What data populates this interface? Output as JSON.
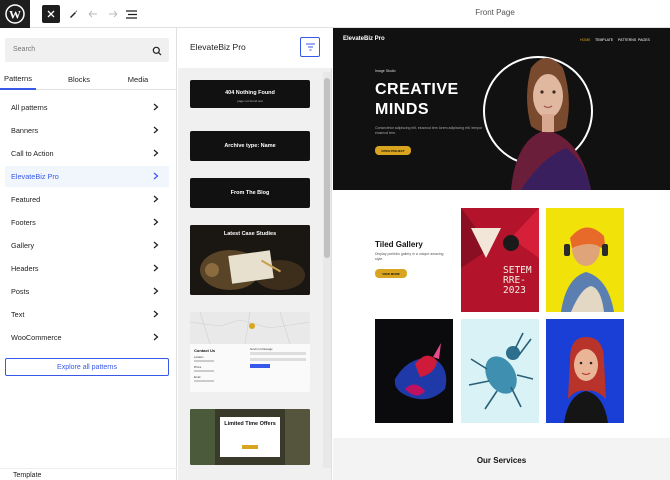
{
  "toolbar": {
    "document_title": "Front Page"
  },
  "sidebar": {
    "search_placeholder": "Search",
    "tabs": [
      {
        "label": "Patterns"
      },
      {
        "label": "Blocks"
      },
      {
        "label": "Media"
      }
    ],
    "categories": [
      {
        "label": "All patterns"
      },
      {
        "label": "Banners"
      },
      {
        "label": "Call to Action"
      },
      {
        "label": "ElevateBiz Pro"
      },
      {
        "label": "Featured"
      },
      {
        "label": "Footers"
      },
      {
        "label": "Gallery"
      },
      {
        "label": "Headers"
      },
      {
        "label": "Posts"
      },
      {
        "label": "Text"
      },
      {
        "label": "WooCommerce"
      }
    ],
    "active_category": "ElevateBiz Pro",
    "explore_label": "Explore all patterns",
    "template_label": "Template"
  },
  "patterns_panel": {
    "title": "ElevateBiz Pro",
    "cards": [
      {
        "label": "404 Nothing Found",
        "sub": "page not found text"
      },
      {
        "label": "Archive type: Name"
      },
      {
        "label": "From The Blog"
      },
      {
        "label": "Latest Case Studies"
      },
      {
        "label": "Contact Us",
        "sub_labels": [
          "Location",
          "Phone",
          "Email",
          "Send Us A Message"
        ]
      },
      {
        "label": "Limited Time Offers"
      }
    ]
  },
  "preview": {
    "brand": "ElevateBiz Pro",
    "nav": [
      "HOME",
      "TEMPLATE",
      "PATTERNS",
      "PAGES"
    ],
    "hero_small": "Image Studio",
    "hero_heading_1": "CREATIVE",
    "hero_heading_2": "MINDS",
    "hero_paragraph": "Consectetur adipiscing elit, eiusmod tem lorem adipiscing elit, tempor eiusmod tem.",
    "hero_button": "OPEN PROJECT",
    "gallery_title": "Tiled Gallery",
    "gallery_paragraph": "Display portfolio gallery in a unique amazing style.",
    "gallery_button": "VIEW MORE",
    "poster_text": [
      "SETEM",
      "RRE-",
      "2023"
    ],
    "services_title": "Our Services"
  },
  "colors": {
    "accent": "#3858e9",
    "gold": "#d9a520",
    "dark": "#111111"
  }
}
